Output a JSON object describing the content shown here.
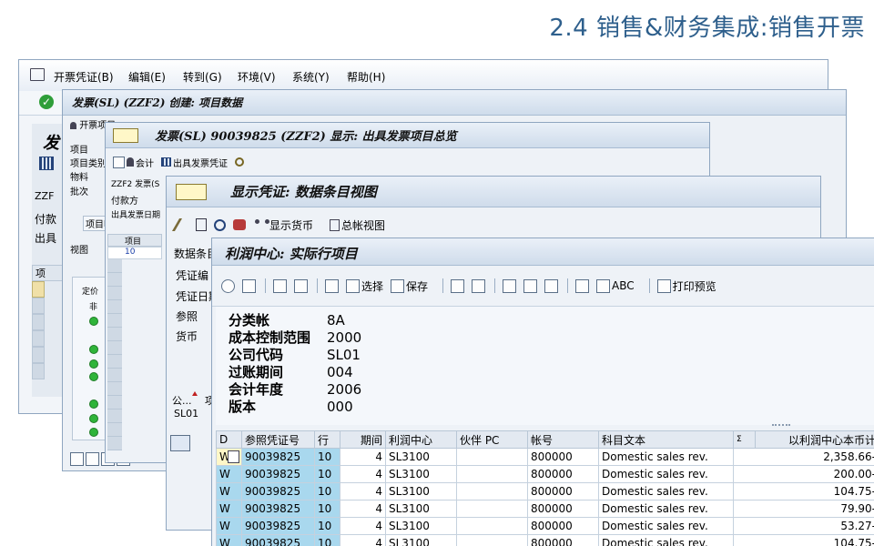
{
  "slide": {
    "title": "2.4 销售&财务集成:销售开票"
  },
  "menubar": {
    "items": [
      "开票凭证(B)",
      "编辑(E)",
      "转到(G)",
      "环境(V)",
      "系统(Y)",
      "帮助(H)"
    ]
  },
  "win1": {
    "title": "发票(SL) (ZZF2) 创建: 项目数据",
    "sub_button": "开票项目",
    "frag_fa": "发",
    "frag_zzf": "ZZF",
    "frag_fukuan": "付款",
    "frag_chuju": "出具",
    "frag_ji": "项"
  },
  "win2": {
    "title": "发票(SL) 90039825 (ZZF2) 显示: 出具发票项目总览",
    "toolbar": {
      "accounting": "会计",
      "issue_invoice": "出具发票凭证"
    },
    "labels": [
      "项目",
      "项目类别",
      "物料",
      "批次"
    ],
    "line1": "ZZF2 发票(S",
    "line2": "付款方",
    "line3": "出具发票日期",
    "tab": "项目明",
    "view": "视图",
    "col_item": "项目",
    "col_item_value": "10",
    "pricing": "定价",
    "col_short": "非"
  },
  "win3": {
    "title": "显示凭证: 数据条目视图",
    "toolbar": {
      "show_currency": "显示货币",
      "gl_view": "总帐视图"
    },
    "labels": [
      "数据条目",
      "凭证编",
      "凭证日期",
      "参照",
      "货币"
    ],
    "col_company": "公...",
    "col_item": "项",
    "company_value": "SL01"
  },
  "win4": {
    "title": "利润中心: 实际行项目",
    "toolbar": {
      "select": "选择",
      "save": "保存",
      "abc": "ABC",
      "print_preview": "打印预览"
    },
    "header_fields": [
      {
        "key": "分类帐",
        "value": "8A"
      },
      {
        "key": "成本控制范围",
        "value": "2000"
      },
      {
        "key": "公司代码",
        "value": "SL01"
      },
      {
        "key": "过账期间",
        "value": "004"
      },
      {
        "key": "会计年度",
        "value": "2006"
      },
      {
        "key": "版本",
        "value": "000"
      }
    ],
    "table": {
      "columns": [
        "D",
        "参照凭证号",
        "行",
        "期间",
        "利润中心",
        "伙伴 PC",
        "帐号",
        "科目文本",
        "Σ",
        "以利润中心本币计"
      ],
      "rows": [
        {
          "d": "W",
          "ref": "90039825",
          "line": "10",
          "period": "4",
          "pc": "SL3100",
          "partner": "",
          "account": "800000",
          "text": "Domestic sales rev.",
          "amount": "2,358.66-"
        },
        {
          "d": "W",
          "ref": "90039825",
          "line": "10",
          "period": "4",
          "pc": "SL3100",
          "partner": "",
          "account": "800000",
          "text": "Domestic sales rev.",
          "amount": "200.00-"
        },
        {
          "d": "W",
          "ref": "90039825",
          "line": "10",
          "period": "4",
          "pc": "SL3100",
          "partner": "",
          "account": "800000",
          "text": "Domestic sales rev.",
          "amount": "104.75-"
        },
        {
          "d": "W",
          "ref": "90039825",
          "line": "10",
          "period": "4",
          "pc": "SL3100",
          "partner": "",
          "account": "800000",
          "text": "Domestic sales rev.",
          "amount": "79.90-"
        },
        {
          "d": "W",
          "ref": "90039825",
          "line": "10",
          "period": "4",
          "pc": "SL3100",
          "partner": "",
          "account": "800000",
          "text": "Domestic sales rev.",
          "amount": "53.27-"
        },
        {
          "d": "W",
          "ref": "90039825",
          "line": "10",
          "period": "4",
          "pc": "SL3100",
          "partner": "",
          "account": "800000",
          "text": "Domestic sales rev.",
          "amount": "104.75-"
        }
      ]
    }
  },
  "colors": {
    "title_blue": "#2e5f8c",
    "key_cell": "#a9d8ee",
    "window_bg": "#eef2f7",
    "green_light": "#2fb43a"
  }
}
